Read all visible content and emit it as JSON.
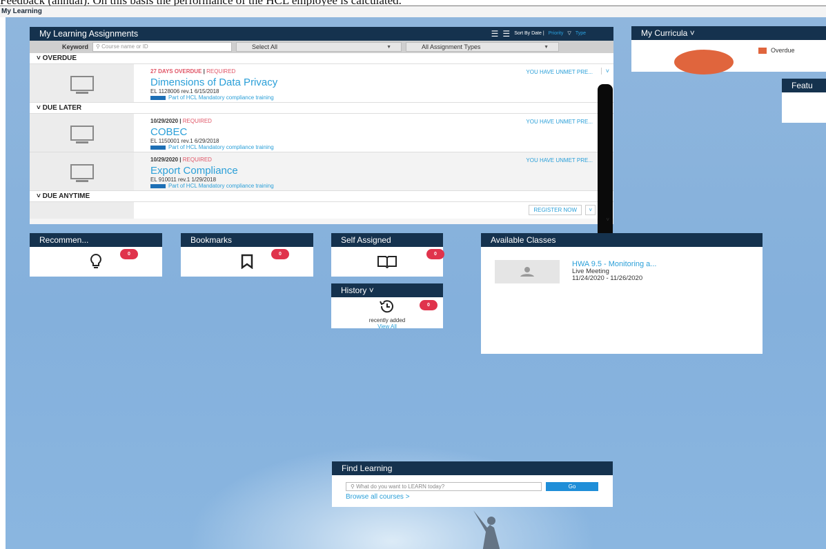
{
  "doc_caption": "Feedback (annual). On this basis the performance of the HCL employee is calculated.",
  "header_title": "My Learning",
  "assignments": {
    "title": "My Learning Assignments",
    "sort_label": "Sort By Date |",
    "sort_priority": "Priority",
    "filter_label": "Type",
    "keyword_label": "Keyword",
    "keyword_placeholder": "Course name or ID",
    "select_all": "Select All",
    "types_select": "All Assignment Types",
    "sections": [
      {
        "label": "OVERDUE",
        "items": [
          {
            "status": "27 DAYS OVERDUE",
            "req": "REQUIRED",
            "title": "Dimensions of Data Privacy",
            "id": "EL 1128006 rev.1 6/15/2018",
            "part": "Part of HCL Mandatory compliance training",
            "prereq": "YOU HAVE UNMET PRE..."
          }
        ]
      },
      {
        "label": "DUE LATER",
        "items": [
          {
            "status": "10/29/2020",
            "req": "REQUIRED",
            "title": "COBEC",
            "id": "EL 1150001 rev.1 6/29/2018",
            "part": "Part of HCL Mandatory compliance training",
            "prereq": "YOU HAVE UNMET PRE..."
          },
          {
            "status": "10/29/2020",
            "req": "REQUIRED",
            "title": "Export Compliance",
            "id": "EL 910011 rev.1 1/29/2018",
            "part": "Part of HCL Mandatory compliance training",
            "prereq": "YOU HAVE UNMET PRE..."
          }
        ]
      },
      {
        "label": "DUE ANYTIME"
      }
    ],
    "register_now": "REGISTER NOW"
  },
  "tiles": {
    "recommended": {
      "title": "Recommen...",
      "count": "0"
    },
    "bookmarks": {
      "title": "Bookmarks",
      "count": "0"
    },
    "self_assigned": {
      "title": "Self Assigned",
      "count": "0"
    },
    "history": {
      "title": "History",
      "count": "0",
      "recent": "recently added",
      "view_all": "View All"
    }
  },
  "curricula": {
    "title": "My Curricula",
    "legend": "Overdue",
    "overdue_color": "#e0653d"
  },
  "featured": {
    "title": "Featu"
  },
  "available": {
    "title": "Available Classes",
    "class_title": "HWA 9.5 - Monitoring a...",
    "class_type": "Live Meeting",
    "class_dates": "11/24/2020 - 11/26/2020"
  },
  "find": {
    "title": "Find Learning",
    "placeholder": "What do you want to LEARN today?",
    "go": "Go",
    "browse": "Browse all courses >"
  },
  "colors": {
    "accent": "#2a9fd8",
    "header": "#15324e",
    "danger": "#e0334c"
  }
}
